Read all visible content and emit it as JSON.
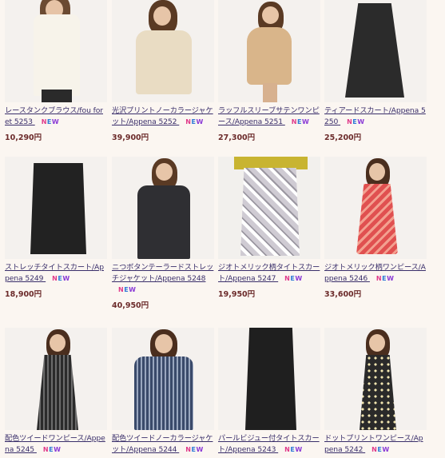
{
  "products": [
    {
      "name": "レースタンクブラウス/fou foret 5253",
      "badge": "NEW",
      "price": "10,290円"
    },
    {
      "name": "光沢プリントノーカラージャケット/Appena 5252",
      "badge": "NEW",
      "price": "39,900円"
    },
    {
      "name": "ラッフルスリーブサテンワンピース/Appena 5251",
      "badge": "NEW",
      "price": "27,300円"
    },
    {
      "name": "ティアードスカート/Appena 5250",
      "badge": "NEW",
      "price": "25,200円"
    },
    {
      "name": "ストレッチタイトスカート/Appena 5249",
      "badge": "NEW",
      "price": "18,900円"
    },
    {
      "name": "ニつボタンテーラードストレッチジャケット/Appena 5248",
      "badge": "NEW",
      "price": "40,950円"
    },
    {
      "name": "ジオトメリック柄タイトスカート/Appena 5247",
      "badge": "NEW",
      "price": "19,950円"
    },
    {
      "name": "ジオトメリック柄ワンピース/Appena 5246",
      "badge": "NEW",
      "price": "33,600円"
    },
    {
      "name": "配色ツイードワンピース/Appena 5245",
      "badge": "NEW",
      "price": ""
    },
    {
      "name": "配色ツイードノーカラージャケット/Appena 5244",
      "badge": "NEW",
      "price": ""
    },
    {
      "name": "パールビジュー付タイトスカート/Appena 5243",
      "badge": "NEW",
      "price": ""
    },
    {
      "name": "ドットプリントワンピース/Appena 5242",
      "badge": "NEW",
      "price": ""
    }
  ],
  "icons": [
    "product-photo"
  ],
  "colors": {
    "link": "#3a2f6b",
    "price": "#6b2a2a",
    "badge_n": "#e03a8a",
    "badge_e": "#2f7ad6",
    "badge_w": "#8a3ad6"
  }
}
